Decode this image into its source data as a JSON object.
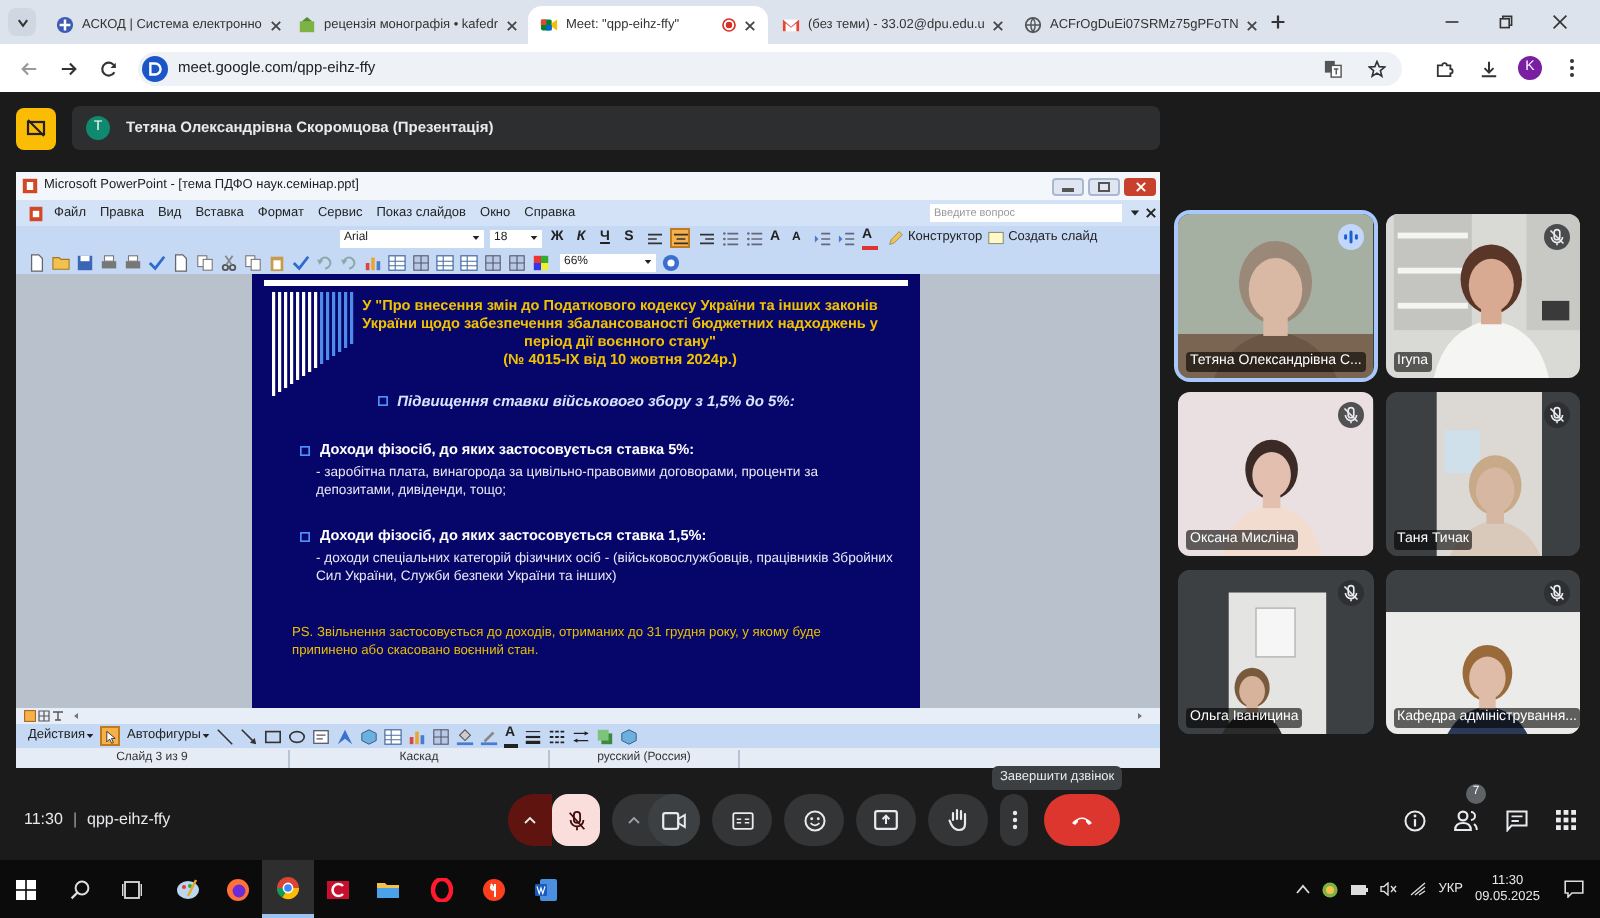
{
  "browser": {
    "tabs": [
      {
        "title": "АСКОД | Система електронно",
        "selected": false
      },
      {
        "title": "рецензія монографія • kafedr",
        "selected": false
      },
      {
        "title": "Meet: \"qpp-eihz-ffy\"",
        "selected": true
      },
      {
        "title": "(без теми) - 33.02@dpu.edu.u",
        "selected": false
      },
      {
        "title": "ACFrOgDuEi07SRMz75gPFoTN",
        "selected": false
      }
    ],
    "url": "meet.google.com/qpp-eihz-ffy",
    "profile_initial": "K"
  },
  "meet": {
    "presenter": {
      "initial": "T",
      "label": "Тетяна Олександрівна Скоромцова (Презентація)"
    },
    "powerpoint": {
      "title": "Microsoft PowerPoint - [тема  ПДФО наук.семінар.ppt]",
      "menu": [
        "Файл",
        "Правка",
        "Вид",
        "Вставка",
        "Формат",
        "Сервис",
        "Показ слайдов",
        "Окно",
        "Справка"
      ],
      "help_placeholder": "Введите вопрос",
      "font": "Arial",
      "font_size": "18",
      "format_buttons": [
        "Ж",
        "К",
        "Ч",
        "S"
      ],
      "align": [
        {
          "selected": false
        },
        {
          "selected": true
        },
        {
          "selected": false
        }
      ],
      "letter_buttons": [
        "A",
        "A",
        "A"
      ],
      "design_button": "Конструктор",
      "new_slide_button": "Создать слайд",
      "zoom": "66%",
      "draw_menus": [
        "Действия",
        "Автофигуры"
      ],
      "draw_font_color": "A",
      "status": [
        "Слайд 3 из 9",
        "Каскад",
        "русский (Россия)"
      ]
    },
    "slide": {
      "title": "У \"Про внесення змін до Податкового кодексу України та інших законів України щодо забезпечення збалансованості бюджетних надходжень у період дії воєнного стану\"",
      "title_number": "(№ 4015-IX від 10 жовтня  2024р.)",
      "heading": "Підвищення ставки військового збору з 1,5% до 5%:",
      "items": [
        {
          "head": "Доходи фізосіб, до яких застосовується ставка 5%:",
          "body": "- заробітна плата, винагорода за цивільно-правовими договорами, проценти за депозитами, дивіденди, тощо;"
        },
        {
          "head": "Доходи фізосіб, до яких застосовується ставка 1,5%:",
          "body": "-  доходи спеціальних категорій фізичних осіб - (військовослужбовців, працівників Збройних Сил України, Служби безпеки України та інших)"
        }
      ],
      "note": "PS. Звільнення застосовується до доходів, отриманих до 31 грудня року, у якому буде припинено або скасовано воєнний стан."
    },
    "participants": [
      {
        "name": "Тетяна Олександрівна С...",
        "speaking": true,
        "muted": false
      },
      {
        "name": "Iryna",
        "speaking": false,
        "muted": true
      },
      {
        "name": "Оксана Мисліна",
        "speaking": false,
        "muted": true
      },
      {
        "name": "Таня Тичак",
        "speaking": false,
        "muted": true
      },
      {
        "name": "Ольга Іваницина",
        "speaking": false,
        "muted": true
      },
      {
        "name": "Кафедра адміністрування...",
        "speaking": false,
        "muted": true
      }
    ],
    "bottom": {
      "time": "11:30",
      "separator": "|",
      "code": "qpp-eihz-ffy",
      "mic_muted": true,
      "tooltip": "Завершити дзвінок",
      "people_count": "7"
    }
  },
  "taskbar": {
    "language": "УКР",
    "time": "11:30",
    "date": "09.05.2025"
  }
}
